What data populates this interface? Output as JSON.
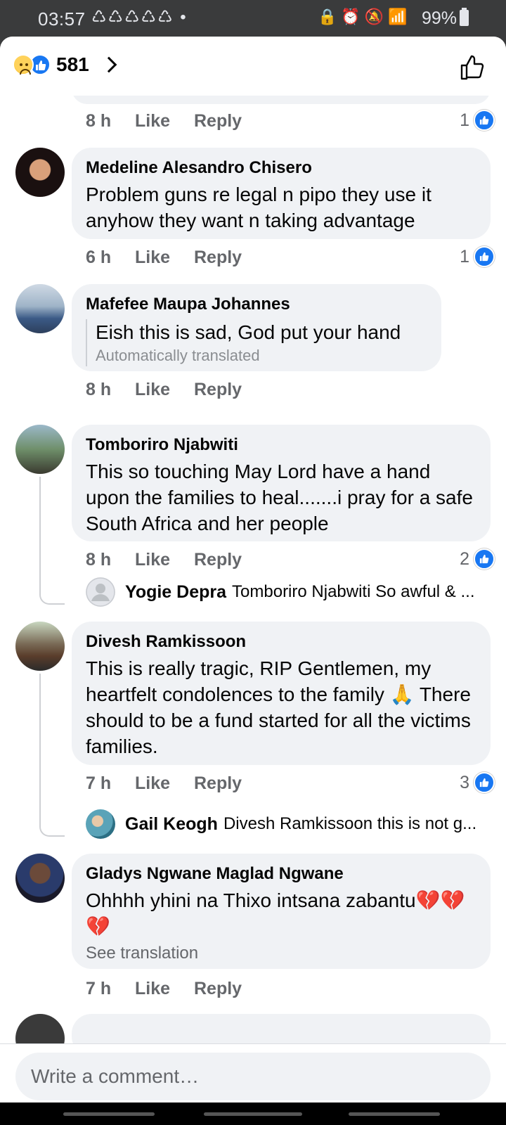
{
  "status_bar": {
    "time": "03:57",
    "notification_icons": "♺♺♺♺♺ •",
    "system_icons": "🔒⏰🔕📶",
    "battery": "99%"
  },
  "header": {
    "reaction_count": "581",
    "reaction_icons": [
      "sad-reaction-icon",
      "like-reaction-icon"
    ]
  },
  "labels": {
    "like": "Like",
    "reply": "Reply"
  },
  "first_comment_meta": {
    "time": "8 h",
    "likes": "1"
  },
  "comments": [
    {
      "author": "Medeline Alesandro Chisero",
      "text": "Problem guns re legal n pipo they use it anyhow they want n taking advantage",
      "time": "6 h",
      "likes": "1"
    },
    {
      "author": "Mafefee Maupa Johannes",
      "text": "Eish this is sad, God put your hand",
      "note": "Automatically translated",
      "time": "8 h"
    },
    {
      "author": "Tomboriro Njabwiti",
      "text": "This so touching May Lord  have a hand upon the families to heal.......i pray for a safe South Africa and her people",
      "time": "8 h",
      "likes": "2",
      "reply": {
        "author": "Yogie Depra",
        "text": "Tomboriro Njabwiti So awful & ..."
      }
    },
    {
      "author": "Divesh Ramkissoon",
      "text": "This is really tragic, RIP Gentlemen, my heartfelt condolences to the family 🙏 There should to be a fund started for all the victims families.",
      "time": "7 h",
      "likes": "3",
      "reply": {
        "author": "Gail Keogh",
        "text": "Divesh Ramkissoon this is not g..."
      }
    },
    {
      "author": "Gladys Ngwane Maglad Ngwane",
      "text": "Ohhhh yhini na Thixo intsana zabantu💔💔💔",
      "see_translation": "See translation",
      "time": "7 h"
    }
  ],
  "footer": {
    "placeholder": "Write a comment…"
  },
  "colors": {
    "accent": "#1877f2",
    "bubble": "#f0f2f5",
    "secondary_text": "#65676b"
  }
}
